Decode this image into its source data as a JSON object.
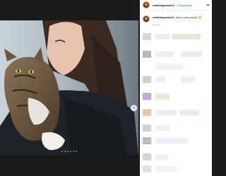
{
  "post": {
    "username": "natalliapazdzinir",
    "separator": "•",
    "follow_label": "Obserwuj",
    "more_icon": "more-horizontal-icon",
    "caption_username": "natalliapazdzinir",
    "caption_text": "jest u was śnieg?",
    "caption_emoji": "smiling-face-icon",
    "time_ago": "1h temu"
  },
  "carousel": {
    "next_icon": "chevron-right-icon",
    "slide_count": 6,
    "active_index": 0
  },
  "colors": {
    "accent": "#3897f0",
    "panel_bg": "#ffffff",
    "modal_bg": "#1a1a1a"
  }
}
